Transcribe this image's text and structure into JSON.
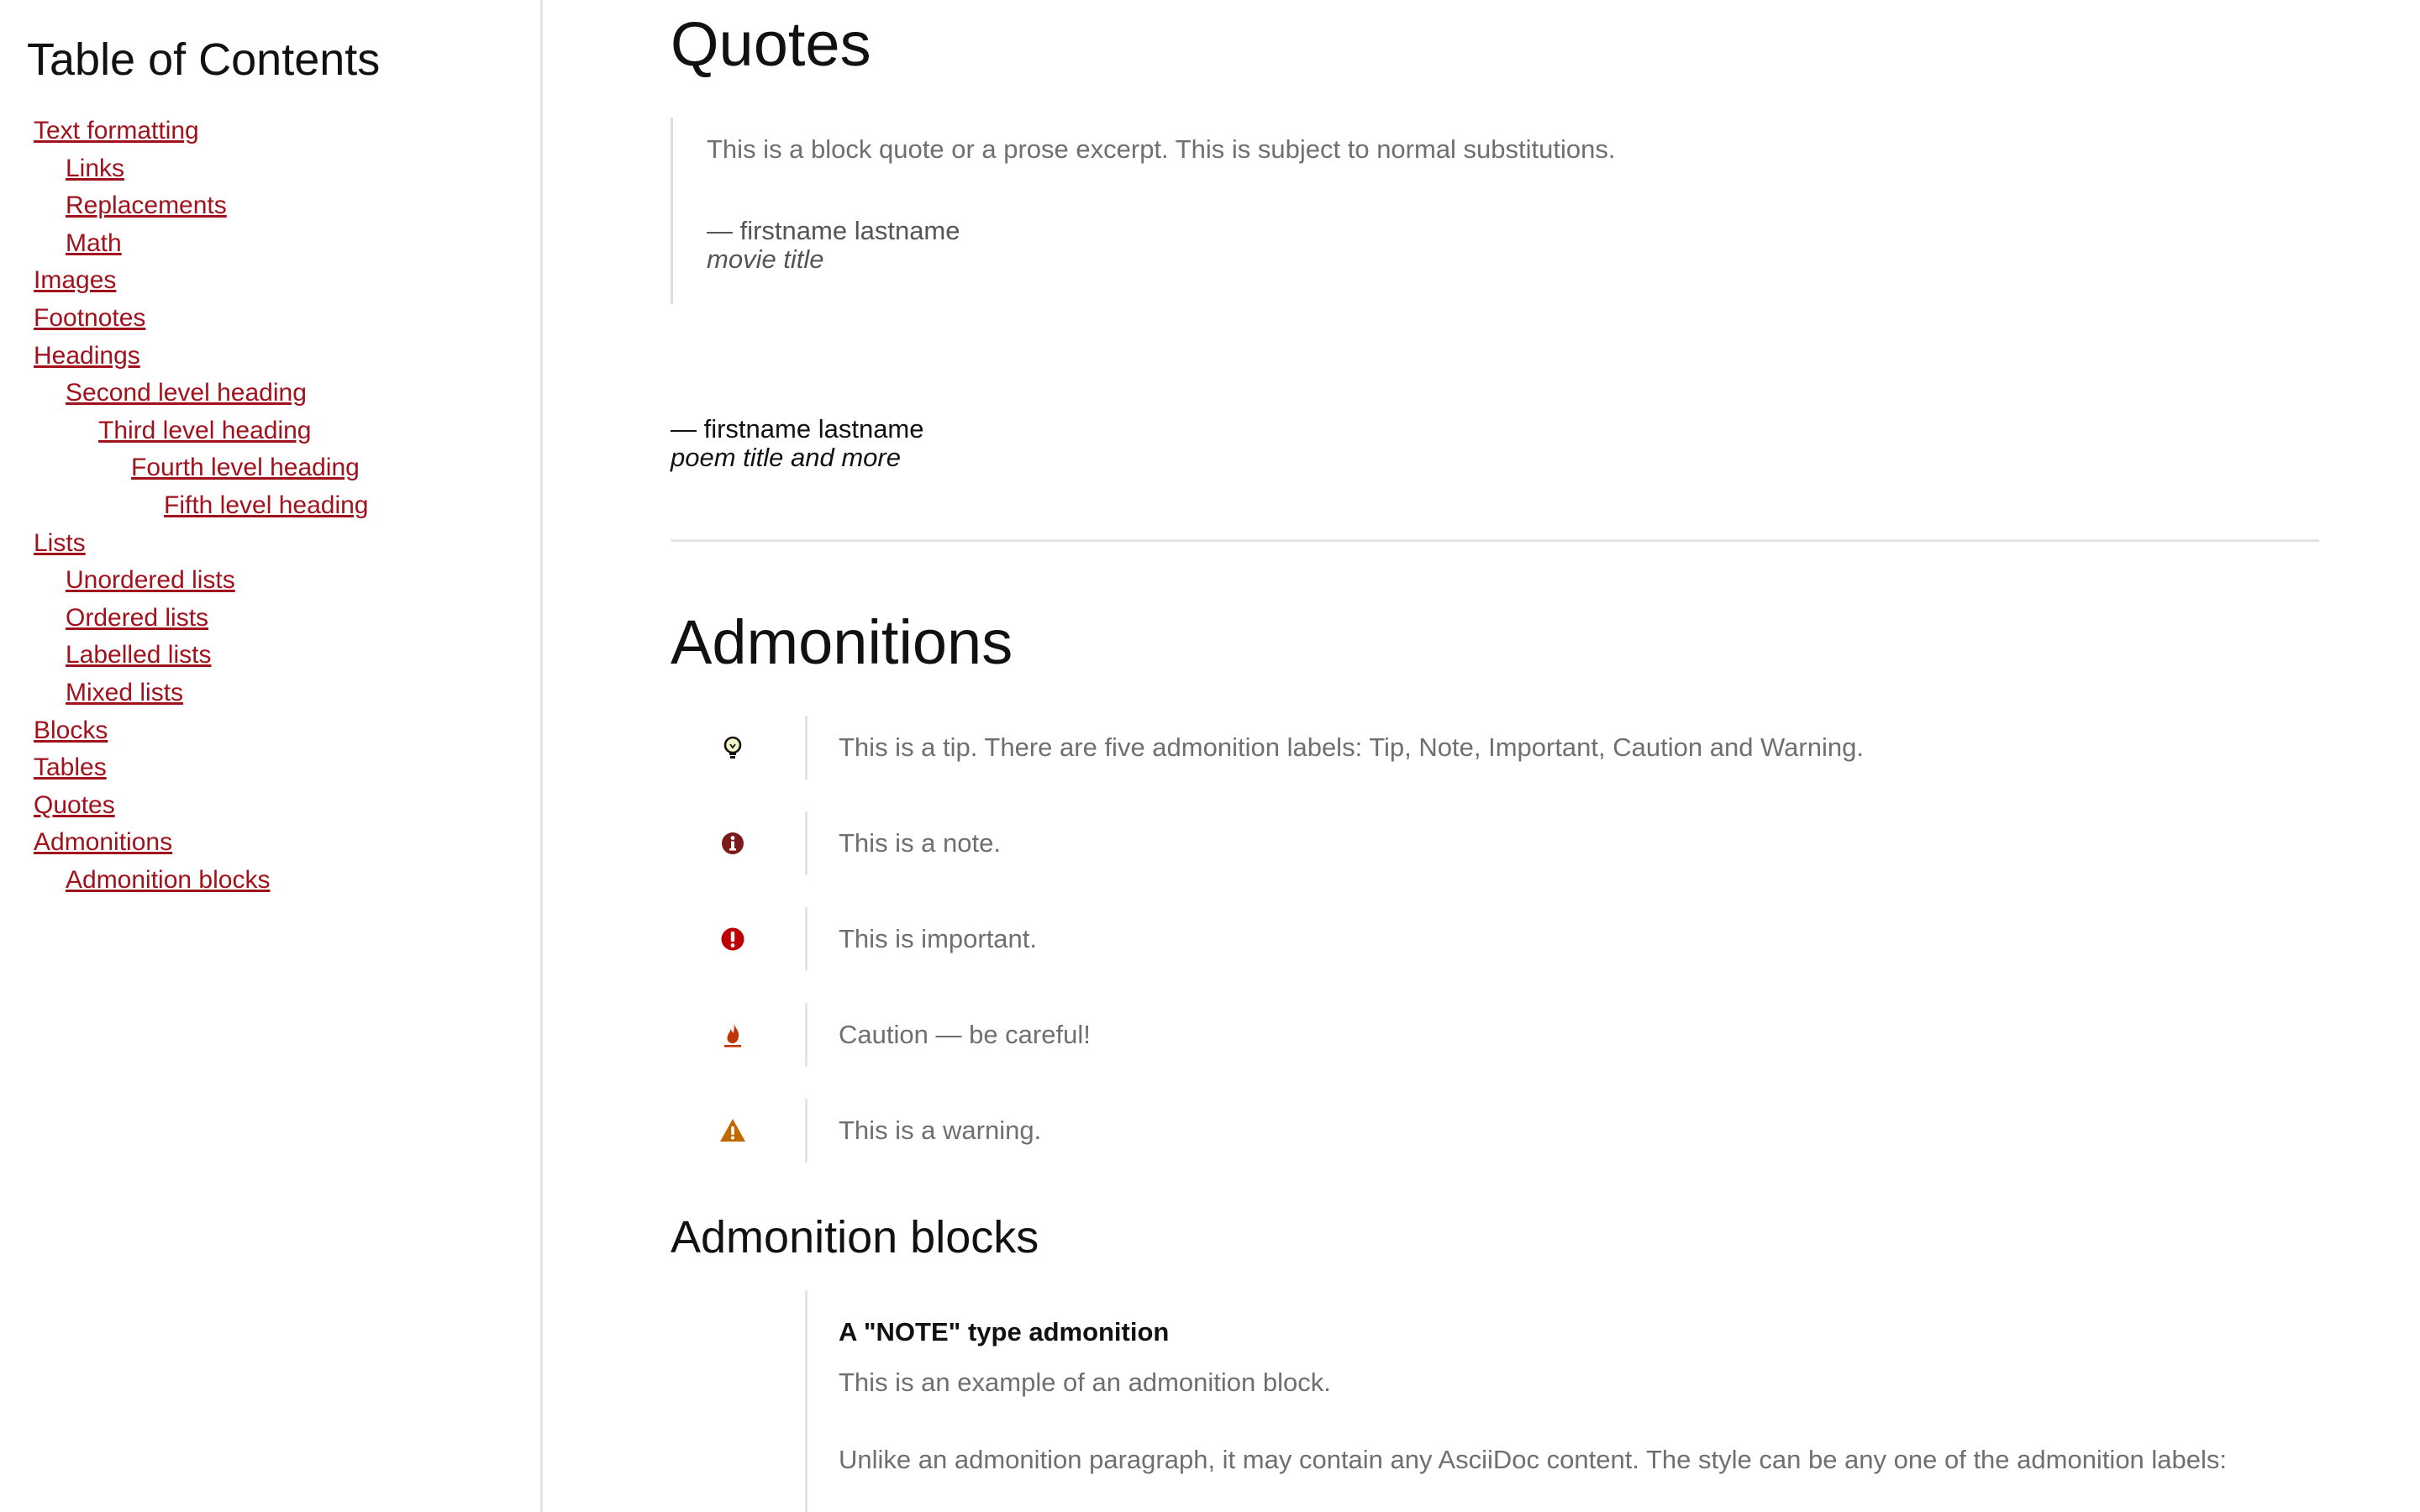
{
  "toc": {
    "title": "Table of Contents",
    "items": [
      {
        "label": "Text formatting"
      },
      {
        "label": "Links"
      },
      {
        "label": "Replacements"
      },
      {
        "label": "Math"
      },
      {
        "label": "Images"
      },
      {
        "label": "Footnotes"
      },
      {
        "label": "Headings"
      },
      {
        "label": "Second level heading"
      },
      {
        "label": "Third level heading"
      },
      {
        "label": "Fourth level heading"
      },
      {
        "label": "Fifth level heading"
      },
      {
        "label": "Lists"
      },
      {
        "label": "Unordered lists"
      },
      {
        "label": "Ordered lists"
      },
      {
        "label": "Labelled lists"
      },
      {
        "label": "Mixed lists"
      },
      {
        "label": "Blocks"
      },
      {
        "label": "Tables"
      },
      {
        "label": "Quotes"
      },
      {
        "label": "Admonitions"
      },
      {
        "label": "Admonition blocks"
      }
    ]
  },
  "quotes": {
    "heading": "Quotes",
    "blockquote": {
      "text": "This is a block quote or a prose excerpt. This is subject to normal substitutions.",
      "attribution": "— firstname lastname",
      "citetitle": "movie title"
    },
    "verse": {
      "attribution": "— firstname lastname",
      "citetitle": "poem title and more"
    }
  },
  "admonitions": {
    "heading": "Admonitions",
    "items": [
      {
        "icon": "lightbulb-icon",
        "color": "#111111",
        "text": "This is a tip. There are five admonition labels: Tip, Note, Important, Caution and Warning."
      },
      {
        "icon": "info-icon",
        "color": "#7a1a1a",
        "text": "This is a note."
      },
      {
        "icon": "exclamation-icon",
        "color": "#bf0000",
        "text": "This is important."
      },
      {
        "icon": "fire-icon",
        "color": "#bf3400",
        "text": "Caution — be careful!"
      },
      {
        "icon": "warning-icon",
        "color": "#bf6900",
        "text": "This is a warning."
      }
    ]
  },
  "admonition_blocks": {
    "heading": "Admonition blocks",
    "title": "A \"NOTE\" type admonition",
    "p1": "This is an example of an admonition block.",
    "p2": "Unlike an admonition paragraph, it may contain any AsciiDoc content. The style can be any one of the admonition labels:"
  }
}
